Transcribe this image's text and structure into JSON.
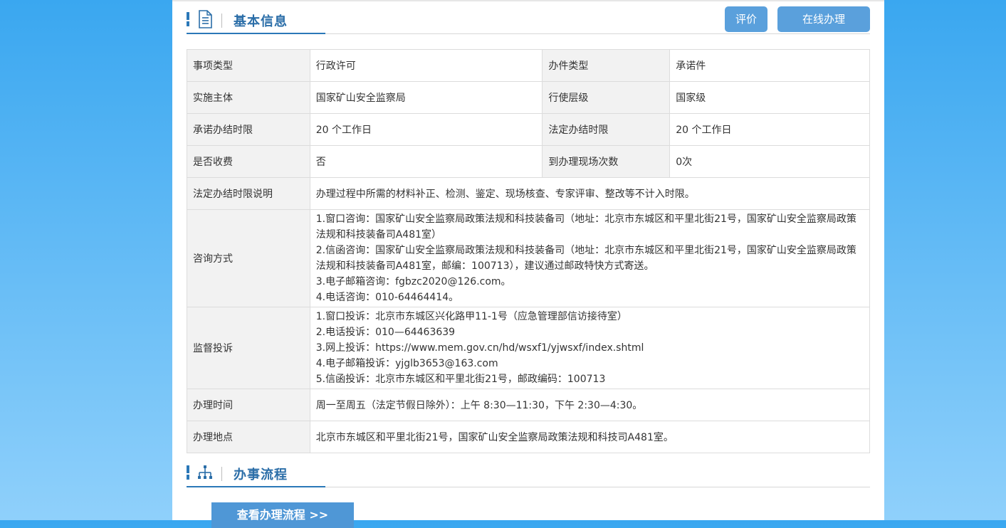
{
  "basic_info": {
    "title": "基本信息",
    "buttons": {
      "rate": "评价",
      "online": "在线办理"
    },
    "rows": [
      {
        "l1": "事项类型",
        "v1": "行政许可",
        "l2": "办件类型",
        "v2": "承诺件"
      },
      {
        "l1": "实施主体",
        "v1": "国家矿山安全监察局",
        "l2": "行使层级",
        "v2": "国家级"
      },
      {
        "l1": "承诺办结时限",
        "v1": "20 个工作日",
        "l2": "法定办结时限",
        "v2": "20 个工作日"
      },
      {
        "l1": "是否收费",
        "v1": "否",
        "l2": "到办理现场次数",
        "v2": "0次"
      }
    ],
    "legal_time_note": {
      "label": "法定办结时限说明",
      "value": "办理过程中所需的材料补正、检测、鉴定、现场核查、专家评审、整改等不计入时限。"
    },
    "consult": {
      "label": "咨询方式",
      "lines": [
        "1.窗口咨询：国家矿山安全监察局政策法规和科技装备司（地址：北京市东城区和平里北街21号，国家矿山安全监察局政策法规和科技装备司A481室）",
        "2.信函咨询：国家矿山安全监察局政策法规和科技装备司（地址：北京市东城区和平里北街21号，国家矿山安全监察局政策法规和科技装备司A481室，邮编：100713），建议通过邮政特快方式寄送。",
        "3.电子邮箱咨询：fgbzc2020@126.com。",
        "4.电话咨询：010-64464414。"
      ]
    },
    "complaint": {
      "label": "监督投诉",
      "lines": [
        "1.窗口投诉：北京市东城区兴化路甲11-1号（应急管理部信访接待室）",
        "2.电话投诉：010—64463639",
        "3.网上投诉：https://www.mem.gov.cn/hd/wsxf1/yjwsxf/index.shtml",
        "4.电子邮箱投诉：yjglb3653@163.com",
        "5.信函投诉：北京市东城区和平里北街21号，邮政编码：100713"
      ]
    },
    "hours": {
      "label": "办理时间",
      "value": "周一至周五（法定节假日除外）：上午 8:30—11:30，下午 2:30—4:30。"
    },
    "location": {
      "label": "办理地点",
      "value": "北京市东城区和平里北街21号，国家矿山安全监察局政策法规和科技司A481室。"
    }
  },
  "process": {
    "title": "办事流程",
    "button": "查看办理流程 >>"
  },
  "colors": {
    "accent": "#2b6ea8",
    "button": "#5aa0dc",
    "label_bg": "#f2f2f2"
  },
  "icons": {
    "basic": "document-icon",
    "process": "sitemap-icon"
  }
}
